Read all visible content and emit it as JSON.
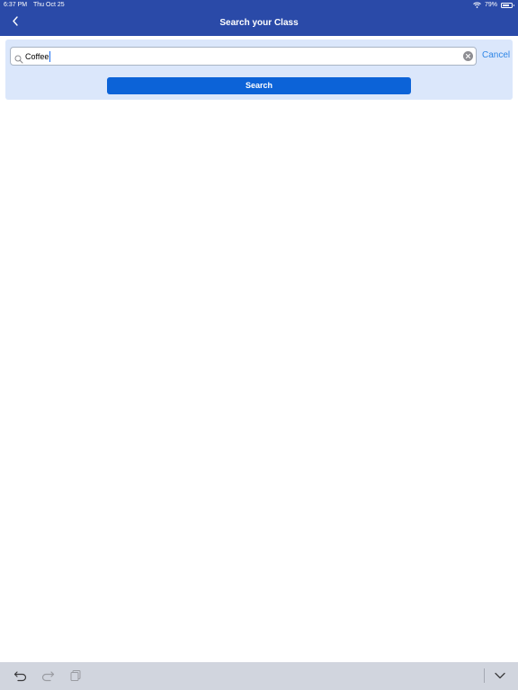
{
  "status_bar": {
    "time": "6:37 PM",
    "date": "Thu Oct 25",
    "battery": "79%",
    "battery_level": 0.79
  },
  "nav": {
    "title": "Search your Class",
    "back_icon": "chevron-left-icon"
  },
  "search": {
    "value": "Coffee",
    "cancel_label": "Cancel",
    "button_label": "Search",
    "icon": "search-icon",
    "clear_icon": "clear-icon"
  },
  "toolbar": {
    "icons": [
      "undo-icon",
      "redo-icon",
      "paste-icon",
      "keyboard-dismiss-icon"
    ]
  },
  "colors": {
    "header": "#2a4aa8",
    "panel": "#dbe7fb",
    "button": "#0c63d8",
    "link": "#2f86e6",
    "toolbar": "#d1d5de"
  }
}
